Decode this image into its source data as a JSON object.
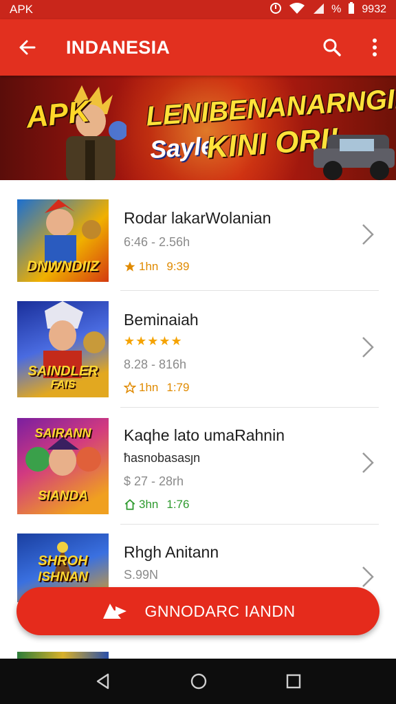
{
  "status_bar": {
    "left_label": "APK",
    "battery_text": "%",
    "time": "9932"
  },
  "app_bar": {
    "title": "INDANESIA"
  },
  "banner": {
    "line_apk": "APK",
    "line1": "LENIBENANARNGIN",
    "line2a": "Sayle",
    "line2b": "KINI ORI!"
  },
  "items": [
    {
      "title": "Rodar lakarWolanian",
      "thumb_text": "DNWNDIIZ",
      "sub": "6:46 - 2.56h",
      "rating_icon": "star",
      "rating_a": "1hn",
      "rating_b": "9:39",
      "rating_color": "#e08a00"
    },
    {
      "title": "Beminaiah",
      "thumb_text": "SAINDLER",
      "thumb_text2": "FAIS",
      "stars": "★★★★★",
      "sub": "8.28 - 816h",
      "rating_icon": "star-outline",
      "rating_a": "1hn",
      "rating_b": "1:79",
      "rating_color": "#e08a00"
    },
    {
      "title": "Kaqhe lato umaRahnin",
      "thumb_text": "SAIRANN",
      "thumb_text2": "SIANDA",
      "sub2": "ħasnobasasȷn",
      "sub": "$ 27 - 28rh",
      "rating_icon": "home-icon",
      "rating_a": "3hn",
      "rating_b": "1:76",
      "rating_color": "#2e9a2e"
    },
    {
      "title": "Rhgh Anitann",
      "thumb_text": "SHROH",
      "thumb_text2": "ISHNAN",
      "sub": "S.99N"
    }
  ],
  "cta": {
    "label": "GNNODARC IANDN",
    "icon": "share-arrow-icon"
  },
  "colors": {
    "primary": "#e2301f",
    "status_bar": "#c9261b",
    "cta": "#e52b1c",
    "nav": "#0d0d0d"
  }
}
